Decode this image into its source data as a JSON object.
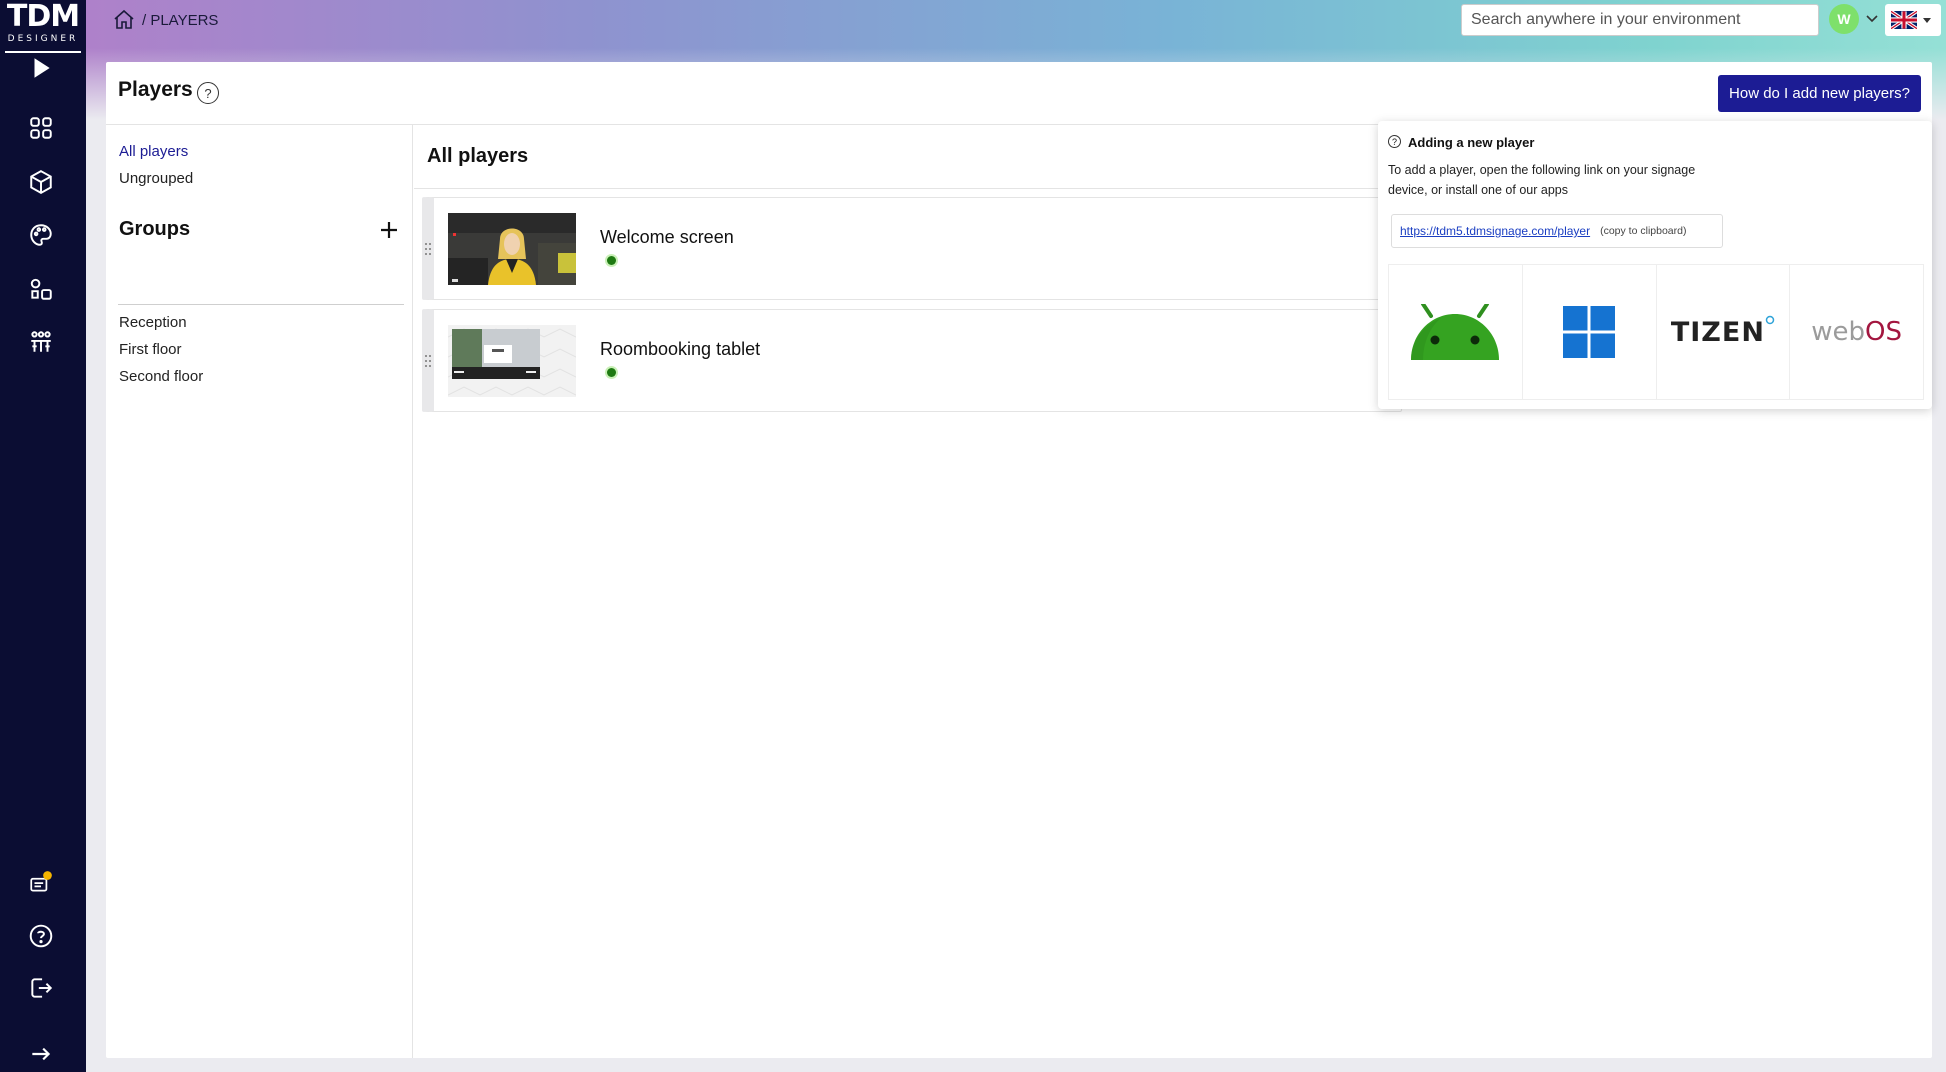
{
  "app": {
    "logo_text": "TDM",
    "logo_subtext": "DESIGNER"
  },
  "breadcrumb": {
    "current": "/ PLAYERS"
  },
  "search": {
    "placeholder": "Search anywhere in your environment"
  },
  "user": {
    "initial": "W"
  },
  "page": {
    "title": "Players",
    "help_symbol": "?",
    "how_button": "How do I add new players?"
  },
  "nav": {
    "all_players": "All players",
    "ungrouped": "Ungrouped",
    "groups_title": "Groups",
    "groups": [
      {
        "label": "Reception"
      },
      {
        "label": "First floor"
      },
      {
        "label": "Second floor"
      }
    ]
  },
  "list": {
    "header": "All players",
    "players": [
      {
        "name": "Welcome screen",
        "status": "online"
      },
      {
        "name": "Roombooking tablet",
        "status": "online"
      }
    ]
  },
  "popover": {
    "title": "Adding a new player",
    "text": "To add a player, open the following link on your signage device, or install one of our apps",
    "url": "https://tdm5.tdmsignage.com/player",
    "copy_label": "(copy to clipboard)",
    "apps": [
      {
        "name": "Android",
        "icon": "android-icon"
      },
      {
        "name": "Windows",
        "icon": "windows-icon"
      },
      {
        "name": "TIZEN",
        "icon": "tizen-logo"
      },
      {
        "name": "webOS",
        "icon": "webos-logo"
      }
    ]
  },
  "colors": {
    "sidebar": "#0b0d33",
    "accent": "#1c1c94",
    "status_online": "#1e7a12",
    "avatar": "#7ee06b"
  }
}
